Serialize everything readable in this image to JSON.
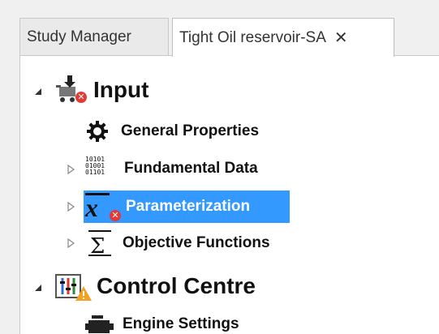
{
  "tabs": [
    {
      "label": "Study Manager",
      "active": false
    },
    {
      "label": "Tight Oil reservoir-SA",
      "active": true,
      "close_icon": "✕"
    }
  ],
  "tree": {
    "input": {
      "label": "Input",
      "icon": "input-cart-icon",
      "expanded": true,
      "children": [
        {
          "label": "General Properties",
          "icon": "gear-icon",
          "expandable": false
        },
        {
          "label": "Fundamental Data",
          "icon": "binary-data-icon",
          "expandable": true,
          "binary_lines": [
            "10101",
            "01001",
            "01101"
          ]
        },
        {
          "label": "Parameterization",
          "icon": "x-bar-parameter-icon",
          "expandable": true,
          "selected": true
        },
        {
          "label": "Objective Functions",
          "icon": "sigma-icon",
          "expandable": true
        }
      ]
    },
    "control_centre": {
      "label": "Control Centre",
      "icon": "control-panel-icon",
      "expanded": true,
      "children": [
        {
          "label": "Engine Settings",
          "icon": "engine-icon",
          "expandable": false
        }
      ]
    }
  },
  "colors": {
    "selection": "#3399ff",
    "error_badge": "#e53935",
    "warning_badge": "#f4a020"
  }
}
